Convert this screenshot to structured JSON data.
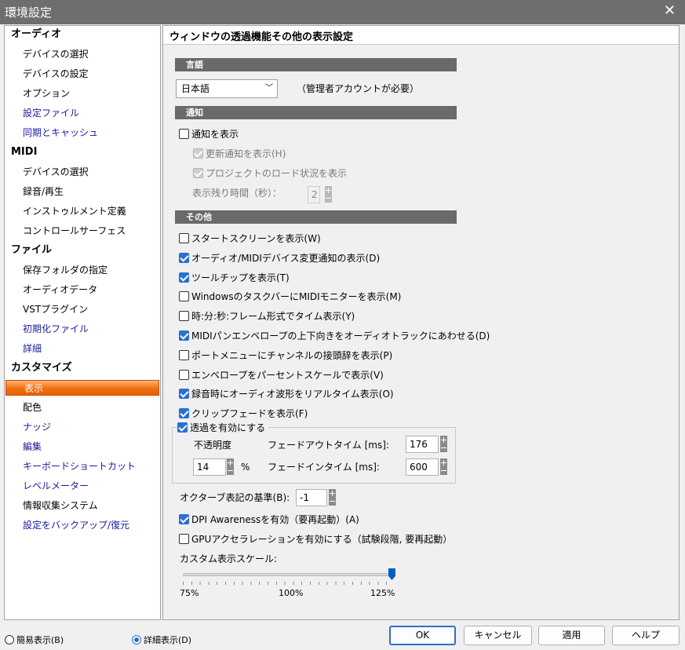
{
  "window": {
    "title": "環境設定",
    "close": "✕"
  },
  "sidebar": {
    "items": [
      {
        "label": "オーディオ",
        "type": "cat"
      },
      {
        "label": "デバイスの選択",
        "type": "sub"
      },
      {
        "label": "デバイスの設定",
        "type": "sub"
      },
      {
        "label": "オプション",
        "type": "sub"
      },
      {
        "label": "設定ファイル",
        "type": "sub link"
      },
      {
        "label": "同期とキャッシュ",
        "type": "sub link"
      },
      {
        "label": "MIDI",
        "type": "cat"
      },
      {
        "label": "デバイスの選択",
        "type": "sub"
      },
      {
        "label": "録音/再生",
        "type": "sub"
      },
      {
        "label": "インストゥルメント定義",
        "type": "sub"
      },
      {
        "label": "コントロールサーフェス",
        "type": "sub"
      },
      {
        "label": "ファイル",
        "type": "cat"
      },
      {
        "label": "保存フォルダの指定",
        "type": "sub"
      },
      {
        "label": "オーディオデータ",
        "type": "sub"
      },
      {
        "label": "VSTプラグイン",
        "type": "sub"
      },
      {
        "label": "初期化ファイル",
        "type": "sub link"
      },
      {
        "label": "詳細",
        "type": "sub link"
      },
      {
        "label": "カスタマイズ",
        "type": "cat"
      },
      {
        "label": "表示",
        "type": "sub sel"
      },
      {
        "label": "配色",
        "type": "sub"
      },
      {
        "label": "ナッジ",
        "type": "sub link"
      },
      {
        "label": "編集",
        "type": "sub link"
      },
      {
        "label": "キーボードショートカット",
        "type": "sub link"
      },
      {
        "label": "レベルメーター",
        "type": "sub link"
      },
      {
        "label": "情報収集システム",
        "type": "sub"
      },
      {
        "label": "設定をバックアップ/復元",
        "type": "sub link"
      }
    ]
  },
  "panel": {
    "title": "ウィンドウの透過機能その他の表示設定",
    "sections": {
      "language": "言語",
      "notify": "通知",
      "other": "その他"
    },
    "language": {
      "value": "日本語",
      "note": "（管理者アカウントが必要）"
    },
    "notify": {
      "show": {
        "label": "通知を表示",
        "checked": false
      },
      "update": {
        "label": "更新通知を表示(H)",
        "checked": true,
        "disabled": true
      },
      "load": {
        "label": "プロジェクトのロード状況を表示",
        "checked": true,
        "disabled": true
      },
      "remain_label": "表示残り時間（秒）：",
      "remain_value": "2"
    },
    "options": [
      {
        "label": "スタートスクリーンを表示(W)",
        "checked": false
      },
      {
        "label": "オーディオ/MIDIデバイス変更通知の表示(D)",
        "checked": true
      },
      {
        "label": "ツールチップを表示(T)",
        "checked": true
      },
      {
        "label": "WindowsのタスクバーにMIDIモニターを表示(M)",
        "checked": false
      },
      {
        "label": "時:分:秒:フレーム形式でタイム表示(Y)",
        "checked": false
      },
      {
        "label": "MIDIパンエンベロープの上下向きをオーディオトラックにあわせる(D)",
        "checked": true
      },
      {
        "label": "ポートメニューにチャンネルの接頭辞を表示(P)",
        "checked": false
      },
      {
        "label": "エンベロープをパーセントスケールで表示(V)",
        "checked": false
      },
      {
        "label": "録音時にオーディオ波形をリアルタイム表示(O)",
        "checked": true
      },
      {
        "label": "クリップフェードを表示(F)",
        "checked": true
      }
    ],
    "transparency": {
      "label": "透過を有効にする",
      "checked": true,
      "opacity_label": "不透明度",
      "opacity_value": "14",
      "percent": "%",
      "fadeout_label": "フェードアウトタイム [ms]:",
      "fadeout_value": "176",
      "fadein_label": "フェードインタイム [ms]:",
      "fadein_value": "600"
    },
    "octave": {
      "label": "オクターブ表記の基準(B):",
      "value": "-1"
    },
    "dpi": {
      "label": "DPI Awarenessを有効（要再起動）(A)",
      "checked": true
    },
    "gpu": {
      "label": "GPUアクセラレーションを有効にする（試験段階, 要再起動）",
      "checked": false
    },
    "scale": {
      "label": "カスタム表示スケール:",
      "min_label": "75%",
      "mid_label": "100%",
      "max_label": "125%",
      "value_percent": 125
    }
  },
  "bottom": {
    "simple": {
      "label": "簡易表示(B)",
      "selected": false
    },
    "detail": {
      "label": "詳細表示(D)",
      "selected": true
    },
    "ok": "OK",
    "cancel": "キャンセル",
    "apply": "適用",
    "help": "ヘルプ"
  }
}
